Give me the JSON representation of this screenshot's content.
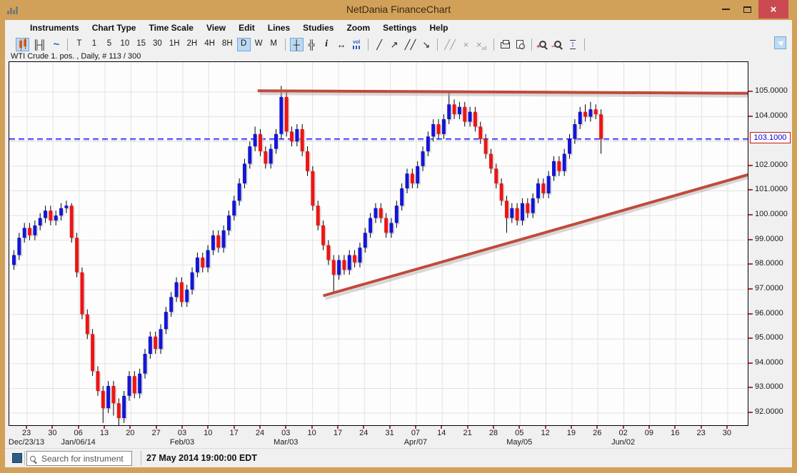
{
  "window": {
    "title": "NetDania FinanceChart"
  },
  "menu": {
    "items": [
      "Instruments",
      "Chart Type",
      "Time Scale",
      "View",
      "Edit",
      "Lines",
      "Studies",
      "Zoom",
      "Settings",
      "Help"
    ]
  },
  "toolbar": {
    "groups": [
      {
        "items": [
          {
            "name": "candlestick-chart-icon",
            "special": "candles",
            "selected": true
          },
          {
            "name": "ohlc-bar-chart-icon",
            "glyph": "╟╢"
          },
          {
            "name": "line-chart-icon",
            "glyph": "~",
            "cls": "blueglyph"
          }
        ]
      },
      {
        "items": [
          {
            "name": "timeframe-tick",
            "label": "T"
          },
          {
            "name": "timeframe-1min",
            "label": "1"
          },
          {
            "name": "timeframe-5min",
            "label": "5"
          },
          {
            "name": "timeframe-10min",
            "label": "10"
          },
          {
            "name": "timeframe-15min",
            "label": "15"
          },
          {
            "name": "timeframe-30min",
            "label": "30"
          },
          {
            "name": "timeframe-1hour",
            "label": "1H"
          },
          {
            "name": "timeframe-2hour",
            "label": "2H"
          },
          {
            "name": "timeframe-4hour",
            "label": "4H"
          },
          {
            "name": "timeframe-8hour",
            "label": "8H"
          },
          {
            "name": "timeframe-daily",
            "label": "D",
            "selected": true
          },
          {
            "name": "timeframe-weekly",
            "label": "W"
          },
          {
            "name": "timeframe-monthly",
            "label": "M"
          }
        ]
      },
      {
        "items": [
          {
            "name": "crosshair-icon",
            "glyph": "┼",
            "selected": true
          },
          {
            "name": "grid-icon",
            "glyph": "╬"
          },
          {
            "name": "info-icon",
            "glyph": "i",
            "cls": "infoglyph"
          },
          {
            "name": "horizontal-scale-icon",
            "glyph": "↔"
          },
          {
            "name": "volume-icon",
            "special": "vol"
          }
        ]
      },
      {
        "items": [
          {
            "name": "trendline-icon",
            "glyph": "╱"
          },
          {
            "name": "ray-line-icon",
            "glyph": "↗"
          },
          {
            "name": "channel-lines-icon",
            "glyph": "╱╱"
          },
          {
            "name": "arrow-draw-icon",
            "glyph": "↘"
          }
        ]
      },
      {
        "items": [
          {
            "name": "parallel-lines-icon",
            "glyph": "╱╱",
            "disabled": true
          },
          {
            "name": "delete-selected-icon",
            "glyph": "×",
            "disabled": true
          },
          {
            "name": "delete-all-icon",
            "special": "xall",
            "disabled": true
          }
        ]
      },
      {
        "items": [
          {
            "name": "print-icon",
            "special": "printer"
          },
          {
            "name": "print-preview-icon",
            "special": "preview"
          }
        ]
      },
      {
        "items": [
          {
            "name": "zoom-in-icon",
            "special": "magnifier",
            "sign": "+"
          },
          {
            "name": "zoom-out-icon",
            "special": "magnifier",
            "sign": "−"
          },
          {
            "name": "fit-vertical-icon",
            "glyph": "↕",
            "cls": "fitv"
          }
        ]
      }
    ],
    "pin_button": {
      "name": "pin-panel-button"
    }
  },
  "chart": {
    "instrument_label": "WTI Crude 1. pos. , Daily, # 113 / 300",
    "current_price_label": "103.1000"
  },
  "chart_data": {
    "type": "candlestick",
    "title": "WTI Crude 1. pos., Daily",
    "bars_shown": 113,
    "bars_total": 300,
    "ylim": [
      91.45,
      106.2
    ],
    "grid": true,
    "up_color": "#1316d3",
    "down_color": "#ed1515",
    "wick_color": "#000000",
    "trendline_color": "#c04a3c",
    "current_price": 103.1,
    "current_price_line_color": "#0000ff",
    "y_ticks": [
      {
        "price": 105,
        "label": "105.0000"
      },
      {
        "price": 104,
        "label": "104.0000"
      },
      {
        "price": 102,
        "label": "102.0000"
      },
      {
        "price": 101,
        "label": "101.0000"
      },
      {
        "price": 100,
        "label": "100.0000"
      },
      {
        "price": 99,
        "label": "99.0000"
      },
      {
        "price": 98,
        "label": "98.0000"
      },
      {
        "price": 97,
        "label": "97.0000"
      },
      {
        "price": 96,
        "label": "96.0000"
      },
      {
        "price": 95,
        "label": "95.0000"
      },
      {
        "price": 94,
        "label": "94.0000"
      },
      {
        "price": 93,
        "label": "93.0000"
      },
      {
        "price": 92,
        "label": "92.0000"
      }
    ],
    "grid_prices": [
      92,
      93,
      94,
      95,
      96,
      97,
      98,
      99,
      100,
      101,
      102,
      103,
      104,
      105
    ],
    "x_weeks": [
      {
        "label": "23",
        "month": "Dec/23/13"
      },
      {
        "label": "30"
      },
      {
        "label": "06",
        "month": "Jan/06/14"
      },
      {
        "label": "13"
      },
      {
        "label": "20"
      },
      {
        "label": "27"
      },
      {
        "label": "03",
        "month": "Feb/03"
      },
      {
        "label": "10"
      },
      {
        "label": "17"
      },
      {
        "label": "24"
      },
      {
        "label": "03",
        "month": "Mar/03"
      },
      {
        "label": "10"
      },
      {
        "label": "17"
      },
      {
        "label": "24"
      },
      {
        "label": "31"
      },
      {
        "label": "07",
        "month": "Apr/07"
      },
      {
        "label": "14"
      },
      {
        "label": "21"
      },
      {
        "label": "28"
      },
      {
        "label": "05",
        "month": "May/05"
      },
      {
        "label": "12"
      },
      {
        "label": "19"
      },
      {
        "label": "26"
      },
      {
        "label": "02",
        "month": "Jun/02"
      },
      {
        "label": "09"
      },
      {
        "label": "16"
      },
      {
        "label": "23"
      },
      {
        "label": "30"
      }
    ],
    "trendlines": [
      {
        "name": "resistance-trendline",
        "from_index": 46.5,
        "from_price": 105.05,
        "to_index": 140,
        "to_price": 104.95
      },
      {
        "name": "support-trendline",
        "from_index": 59,
        "from_price": 96.75,
        "to_index": 140,
        "to_price": 101.65
      }
    ],
    "candles": [
      [
        98.0,
        98.6,
        97.8,
        98.4
      ],
      [
        98.4,
        99.3,
        98.2,
        99.1
      ],
      [
        99.1,
        99.7,
        98.9,
        99.5
      ],
      [
        99.5,
        99.7,
        99.0,
        99.2
      ],
      [
        99.2,
        99.8,
        99.0,
        99.6
      ],
      [
        99.6,
        100.1,
        99.4,
        99.9
      ],
      [
        99.9,
        100.4,
        99.7,
        100.2
      ],
      [
        100.2,
        100.4,
        99.6,
        99.8
      ],
      [
        99.8,
        100.2,
        99.6,
        100.0
      ],
      [
        100.0,
        100.5,
        99.8,
        100.3
      ],
      [
        100.3,
        100.6,
        100.1,
        100.4
      ],
      [
        100.4,
        100.5,
        98.9,
        99.1
      ],
      [
        99.1,
        99.3,
        97.5,
        97.7
      ],
      [
        97.7,
        97.9,
        95.8,
        96.0
      ],
      [
        96.0,
        96.2,
        95.0,
        95.2
      ],
      [
        95.2,
        95.4,
        93.5,
        93.7
      ],
      [
        93.7,
        93.9,
        92.7,
        92.9
      ],
      [
        92.9,
        93.1,
        91.6,
        92.2
      ],
      [
        92.2,
        93.3,
        92.0,
        93.1
      ],
      [
        93.1,
        93.3,
        91.9,
        92.4
      ],
      [
        92.4,
        92.6,
        91.4,
        91.8
      ],
      [
        91.8,
        92.9,
        91.6,
        92.7
      ],
      [
        92.7,
        93.7,
        92.5,
        93.5
      ],
      [
        93.5,
        93.7,
        92.6,
        92.8
      ],
      [
        92.8,
        93.8,
        92.6,
        93.6
      ],
      [
        93.6,
        94.6,
        93.4,
        94.4
      ],
      [
        94.4,
        95.3,
        94.2,
        95.1
      ],
      [
        95.1,
        95.3,
        94.4,
        94.6
      ],
      [
        94.6,
        95.6,
        94.4,
        95.4
      ],
      [
        95.4,
        96.3,
        95.2,
        96.1
      ],
      [
        96.1,
        96.9,
        95.9,
        96.7
      ],
      [
        96.7,
        97.5,
        96.5,
        97.3
      ],
      [
        97.3,
        97.5,
        96.3,
        96.5
      ],
      [
        96.5,
        97.2,
        96.3,
        97.0
      ],
      [
        97.0,
        97.9,
        96.8,
        97.7
      ],
      [
        97.7,
        98.5,
        97.5,
        98.3
      ],
      [
        98.3,
        98.5,
        97.7,
        97.9
      ],
      [
        97.9,
        98.8,
        97.7,
        98.6
      ],
      [
        98.6,
        99.4,
        98.4,
        99.2
      ],
      [
        99.2,
        99.4,
        98.5,
        98.7
      ],
      [
        98.7,
        99.6,
        98.5,
        99.4
      ],
      [
        99.4,
        100.2,
        99.2,
        100.0
      ],
      [
        100.0,
        100.8,
        99.8,
        100.6
      ],
      [
        100.6,
        101.5,
        100.4,
        101.3
      ],
      [
        101.3,
        102.3,
        101.1,
        102.1
      ],
      [
        102.1,
        103.0,
        101.9,
        102.8
      ],
      [
        102.8,
        103.6,
        102.6,
        103.3
      ],
      [
        103.3,
        103.5,
        102.4,
        102.6
      ],
      [
        102.6,
        102.8,
        101.9,
        102.1
      ],
      [
        102.1,
        102.9,
        101.9,
        102.7
      ],
      [
        102.7,
        103.5,
        102.5,
        103.3
      ],
      [
        103.3,
        105.25,
        103.1,
        104.8
      ],
      [
        104.8,
        105.0,
        103.2,
        103.4
      ],
      [
        103.4,
        103.6,
        102.8,
        103.0
      ],
      [
        103.0,
        103.7,
        102.8,
        103.5
      ],
      [
        103.5,
        103.7,
        102.4,
        102.6
      ],
      [
        102.6,
        102.8,
        101.6,
        101.8
      ],
      [
        101.8,
        102.0,
        100.2,
        100.4
      ],
      [
        100.4,
        100.6,
        99.4,
        99.6
      ],
      [
        99.6,
        99.8,
        98.6,
        98.8
      ],
      [
        98.8,
        99.0,
        98.0,
        98.2
      ],
      [
        98.2,
        98.4,
        96.9,
        97.6
      ],
      [
        97.6,
        98.4,
        97.4,
        98.2
      ],
      [
        98.2,
        98.4,
        97.6,
        97.8
      ],
      [
        97.8,
        98.6,
        97.6,
        98.4
      ],
      [
        98.4,
        98.6,
        97.9,
        98.1
      ],
      [
        98.1,
        98.9,
        97.9,
        98.7
      ],
      [
        98.7,
        99.5,
        98.5,
        99.3
      ],
      [
        99.3,
        100.1,
        99.1,
        99.9
      ],
      [
        99.9,
        100.5,
        99.7,
        100.3
      ],
      [
        100.3,
        100.5,
        99.7,
        99.9
      ],
      [
        99.9,
        100.1,
        99.1,
        99.3
      ],
      [
        99.3,
        99.9,
        99.1,
        99.7
      ],
      [
        99.7,
        100.6,
        99.5,
        100.4
      ],
      [
        100.4,
        101.3,
        100.2,
        101.1
      ],
      [
        101.1,
        101.9,
        100.9,
        101.7
      ],
      [
        101.7,
        101.9,
        101.1,
        101.3
      ],
      [
        101.3,
        102.2,
        101.1,
        102.0
      ],
      [
        102.0,
        102.8,
        101.8,
        102.6
      ],
      [
        102.6,
        103.4,
        102.4,
        103.2
      ],
      [
        103.2,
        103.9,
        103.0,
        103.7
      ],
      [
        103.7,
        103.9,
        103.1,
        103.3
      ],
      [
        103.3,
        104.1,
        103.1,
        103.9
      ],
      [
        103.9,
        105.0,
        103.7,
        104.5
      ],
      [
        104.5,
        104.7,
        103.9,
        104.1
      ],
      [
        104.1,
        104.6,
        103.9,
        104.4
      ],
      [
        104.4,
        104.6,
        103.6,
        103.8
      ],
      [
        103.8,
        104.4,
        103.6,
        104.2
      ],
      [
        104.2,
        104.4,
        103.4,
        103.6
      ],
      [
        103.6,
        103.8,
        102.9,
        103.1
      ],
      [
        103.1,
        103.3,
        102.3,
        102.5
      ],
      [
        102.5,
        102.7,
        101.7,
        101.9
      ],
      [
        101.9,
        102.1,
        101.1,
        101.3
      ],
      [
        101.3,
        101.5,
        100.4,
        100.6
      ],
      [
        100.6,
        100.8,
        99.3,
        99.9
      ],
      [
        99.9,
        100.5,
        99.7,
        100.3
      ],
      [
        100.3,
        100.5,
        99.6,
        99.8
      ],
      [
        99.8,
        100.7,
        99.6,
        100.5
      ],
      [
        100.5,
        100.7,
        99.9,
        100.1
      ],
      [
        100.1,
        100.9,
        99.9,
        100.7
      ],
      [
        100.7,
        101.5,
        100.5,
        101.3
      ],
      [
        101.3,
        101.5,
        100.7,
        100.9
      ],
      [
        100.9,
        101.8,
        100.7,
        101.6
      ],
      [
        101.6,
        102.4,
        101.4,
        102.2
      ],
      [
        102.2,
        102.4,
        101.6,
        101.8
      ],
      [
        101.8,
        102.7,
        101.6,
        102.5
      ],
      [
        102.5,
        103.3,
        102.3,
        103.1
      ],
      [
        103.1,
        103.9,
        102.9,
        103.7
      ],
      [
        103.7,
        104.4,
        103.5,
        104.2
      ],
      [
        104.2,
        104.5,
        103.8,
        104.0
      ],
      [
        104.0,
        104.6,
        103.8,
        104.3
      ],
      [
        104.3,
        104.5,
        103.9,
        104.1
      ],
      [
        104.1,
        104.3,
        102.5,
        103.1
      ]
    ]
  },
  "statusbar": {
    "search_placeholder": "Search for instrument",
    "timestamp": "27 May 2014 19:00:00 EDT"
  }
}
